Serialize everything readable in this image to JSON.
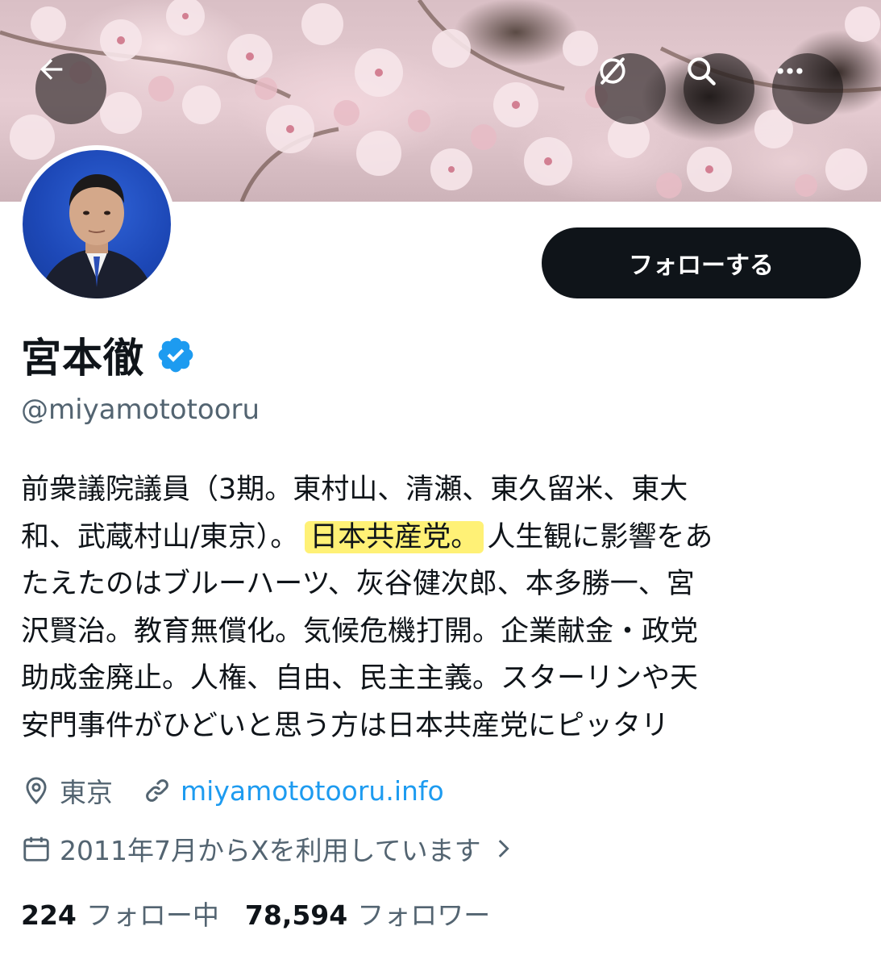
{
  "profile": {
    "name": "宮本徹",
    "handle": "@miyamototooru",
    "verified": true,
    "follow_label": "フォローする",
    "bio_lines": [
      "前衆議院議員（3期。東村山、清瀬、東久留米、東大",
      "和、武蔵村山/東京）。",
      "日本共産党。",
      "人生観に影響をあ",
      "たえたのはブルーハーツ、灰谷健次郎、本多勝一、宮",
      "沢賢治。教育無償化。気候危機打開。企業献金・政党",
      "助成金廃止。人権、自由、民主主義。スターリンや天",
      "安門事件がひどいと思う方は日本共産党にピッタリ"
    ],
    "location": "東京",
    "website": "miyamototooru.info",
    "joined": "2011年7月からXを利用しています",
    "following_count": "224",
    "following_label": "フォロー中",
    "followers_count": "78,594",
    "followers_label": "フォロワー"
  },
  "icons": {
    "back": "arrow-left-icon",
    "grok": "grok-icon",
    "search": "search-icon",
    "more": "more-icon",
    "verified": "verified-badge-icon",
    "location": "location-pin-icon",
    "link": "link-icon",
    "calendar": "calendar-icon",
    "chevron": "chevron-right-icon"
  },
  "colors": {
    "accent": "#1d9bf0",
    "highlight": "#fff176",
    "text": "#0f1419",
    "secondary": "#536471"
  }
}
